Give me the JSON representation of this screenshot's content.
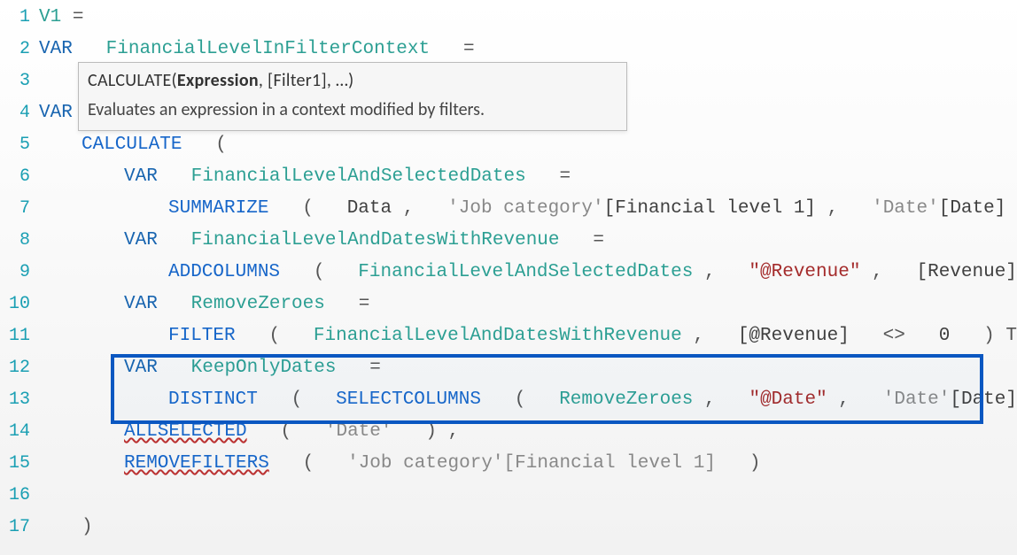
{
  "gutter": [
    "1",
    "2",
    "3",
    "4",
    "5",
    "6",
    "7",
    "8",
    "9",
    "10",
    "11",
    "12",
    "13",
    "14",
    "15",
    "16",
    "17"
  ],
  "line1": {
    "ident": "V1",
    "op": "="
  },
  "line2": {
    "kw": "VAR",
    "ident": "FinancialLevelInFilterContext",
    "op": "="
  },
  "tooltip": {
    "sig_func": "CALCULATE(",
    "sig_bold": "Expression",
    "sig_rest": ", [Filter1], …)",
    "desc": "Evaluates an expression in a context modified by filters."
  },
  "line4": {
    "kw": "VAR"
  },
  "line5": {
    "func": "CALCULATE",
    "paren": "("
  },
  "line6": {
    "kw": "VAR",
    "ident": "FinancialLevelAndSelectedDates",
    "op": "="
  },
  "line7": {
    "func": "SUMMARIZE",
    "args_open": "(",
    "arg1": "Data",
    "comma1": ",",
    "tab1": "'Job category'",
    "col1": "[Financial level 1]",
    "comma2": ",",
    "tab2": "'Date'",
    "col2": "[Date]",
    "close": ")"
  },
  "line8": {
    "kw": "VAR",
    "ident": "FinancialLevelAndDatesWithRevenue",
    "op": "="
  },
  "line9": {
    "func": "ADDCOLUMNS",
    "open": "(",
    "arg1": "FinancialLevelAndSelectedDates",
    "comma1": ",",
    "str": "\"@Revenue\"",
    "comma2": ",",
    "col": "[Revenue]",
    "close": ")"
  },
  "line10": {
    "kw": "VAR",
    "ident": "RemoveZeroes",
    "op": "="
  },
  "line11": {
    "func": "FILTER",
    "open": "(",
    "arg1": "FinancialLevelAndDatesWithRevenue",
    "comma": ",",
    "col": "[@Revenue]",
    "op": "<>",
    "zero": "0",
    "close": ")",
    "cursor": "T"
  },
  "line12": {
    "kw": "VAR",
    "ident": "KeepOnlyDates",
    "op": "="
  },
  "line13": {
    "func1": "DISTINCT",
    "open1": "(",
    "func2": "SELECTCOLUMNS",
    "open2": "(",
    "arg1": "RemoveZeroes",
    "comma1": ",",
    "str": "\"@Date\"",
    "comma2": ",",
    "tab": "'Date'",
    "col": "[Date]",
    "close2": ")",
    "close1": ")"
  },
  "line14": {
    "func": "ALLSELECTED",
    "open": "(",
    "tab": "'Date'",
    "close": ")",
    "comma": ","
  },
  "line15": {
    "func": "REMOVEFILTERS",
    "open": "(",
    "tab": "'Job category'",
    "col": "[Financial level 1]",
    "close": ")"
  },
  "line17": {
    "close": ")"
  }
}
